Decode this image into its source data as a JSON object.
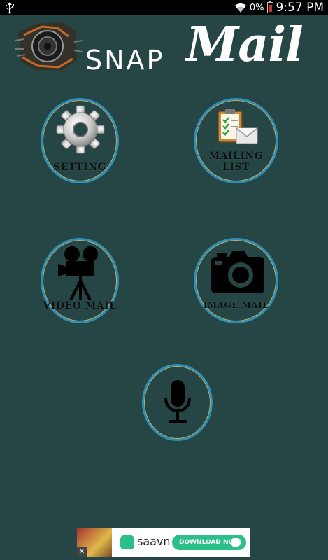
{
  "status_bar": {
    "battery_percent": "0%",
    "time": "9:57 PM",
    "icons": [
      "usb-icon",
      "wifi-icon",
      "battery-icon"
    ]
  },
  "logo": {
    "snap": "SNAP",
    "mail": "Mail"
  },
  "buttons": {
    "setting": {
      "label": "SETTING",
      "icon": "gear-icon"
    },
    "mailing_list": {
      "label": "MAILING LIST",
      "icon": "clipboard-mail-icon"
    },
    "video_mail": {
      "label": "VIDEO MAIL",
      "icon": "video-camera-icon"
    },
    "image_mail": {
      "label": "IMAGE MAIL",
      "icon": "camera-icon"
    },
    "voice": {
      "icon": "microphone-icon"
    }
  },
  "ad": {
    "brand": "saavn",
    "cta": "DOWNLOAD NOW",
    "close": "✕"
  },
  "colors": {
    "background": "#264645",
    "ring": "#2e8fb7",
    "ring_inner": "#c6b36a",
    "ad_accent": "#2bbf89"
  }
}
